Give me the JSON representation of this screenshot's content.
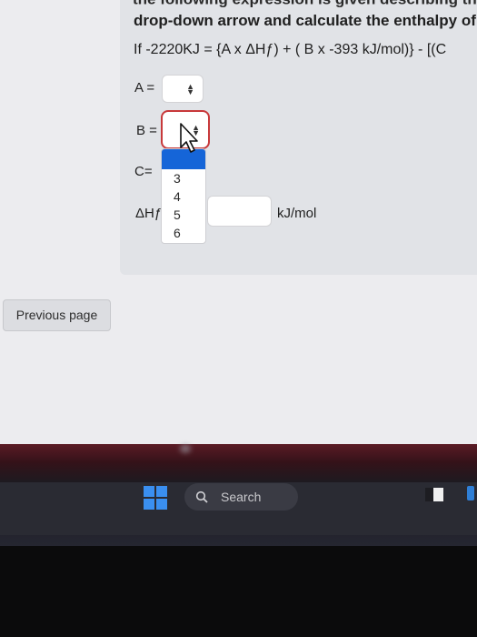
{
  "question": {
    "top_cut_text": "the following expression is given describing th",
    "instruction": "drop-down arrow and calculate the enthalpy of f",
    "equation": "If -2220KJ = {A x ΔHƒ) + ( B x -393 kJ/mol)} - [(C"
  },
  "fields": {
    "a_label": "A =",
    "b_label": "B =",
    "c_label": "C=",
    "dh_label": "ΔHƒ",
    "unit": "kJ/mol"
  },
  "dropdown": {
    "selected": "",
    "options": [
      "3",
      "4",
      "5",
      "6"
    ]
  },
  "nav": {
    "previous_label": "Previous page"
  },
  "taskbar": {
    "search_label": "Search"
  },
  "colors": {
    "focus_ring": "#c8393b",
    "dropdown_highlight": "#1565d8",
    "windows_blue": "#3a8ff0"
  }
}
